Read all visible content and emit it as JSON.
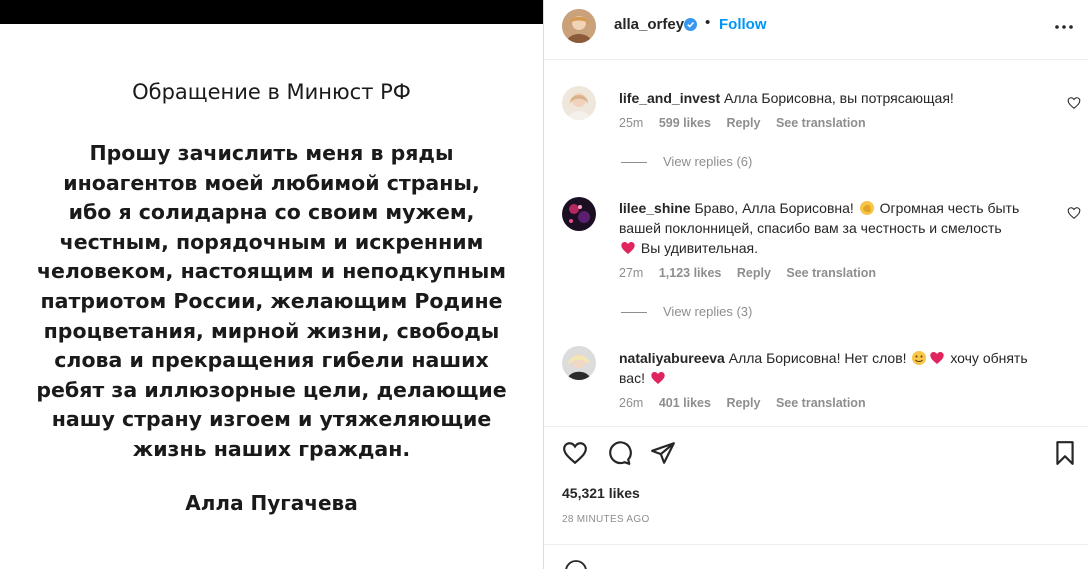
{
  "post_image": {
    "heading": "Обращение в Минюст РФ",
    "body_lines": [
      "Прошу зачислить меня в ряды",
      "иноагентов моей любимой страны,",
      "ибо я солидарна со своим мужем,",
      "честным, порядочным и искренним",
      "человеком, настоящим и неподкупным",
      "патриотом России, желающим Родине",
      "процветания, мирной жизни, свободы",
      "слова и прекращения гибели наших",
      "ребят за иллюзорные цели, делающие",
      "нашу страну изгоем и утяжеляющие",
      "жизнь наших граждан."
    ],
    "signature": "Алла Пугачева"
  },
  "header": {
    "username": "alla_orfey",
    "dot": "•",
    "follow_label": "Follow"
  },
  "comments": [
    {
      "username": "life_and_invest",
      "text": "Алла Борисовна, вы потрясающая!",
      "time": "25m",
      "likes": "599 likes",
      "reply_label": "Reply",
      "translation_label": "See translation",
      "view_replies": "View replies (6)"
    },
    {
      "username": "lilee_shine",
      "text_1": "Браво, Алла Борисовна!",
      "text_2": "Огромная честь быть вашей поклонницей, спасибо вам за честность и смелость",
      "text_3": "Вы удивительная.",
      "time": "27m",
      "likes": "1,123 likes",
      "reply_label": "Reply",
      "translation_label": "See translation",
      "view_replies": "View replies (3)"
    },
    {
      "username": "nataliyabureeva",
      "text_1": "Алла Борисовна! Нет слов!",
      "text_2": "хочу обнять вас!",
      "time": "26m",
      "likes": "401 likes",
      "reply_label": "Reply",
      "translation_label": "See translation"
    }
  ],
  "footer": {
    "likes": "45,321 likes",
    "time_ago": "28 MINUTES AGO"
  },
  "icons": {
    "verified": "verified-badge-icon",
    "more": "more-options-icon",
    "like": "heart-icon",
    "comment": "comment-icon",
    "share": "share-icon",
    "save": "bookmark-icon",
    "emoji": "emoji-icon"
  },
  "colors": {
    "link_blue": "#0095f6",
    "muted": "#8e8e8e",
    "heart_red": "#e0245e",
    "verified_blue": "#3897f0"
  }
}
